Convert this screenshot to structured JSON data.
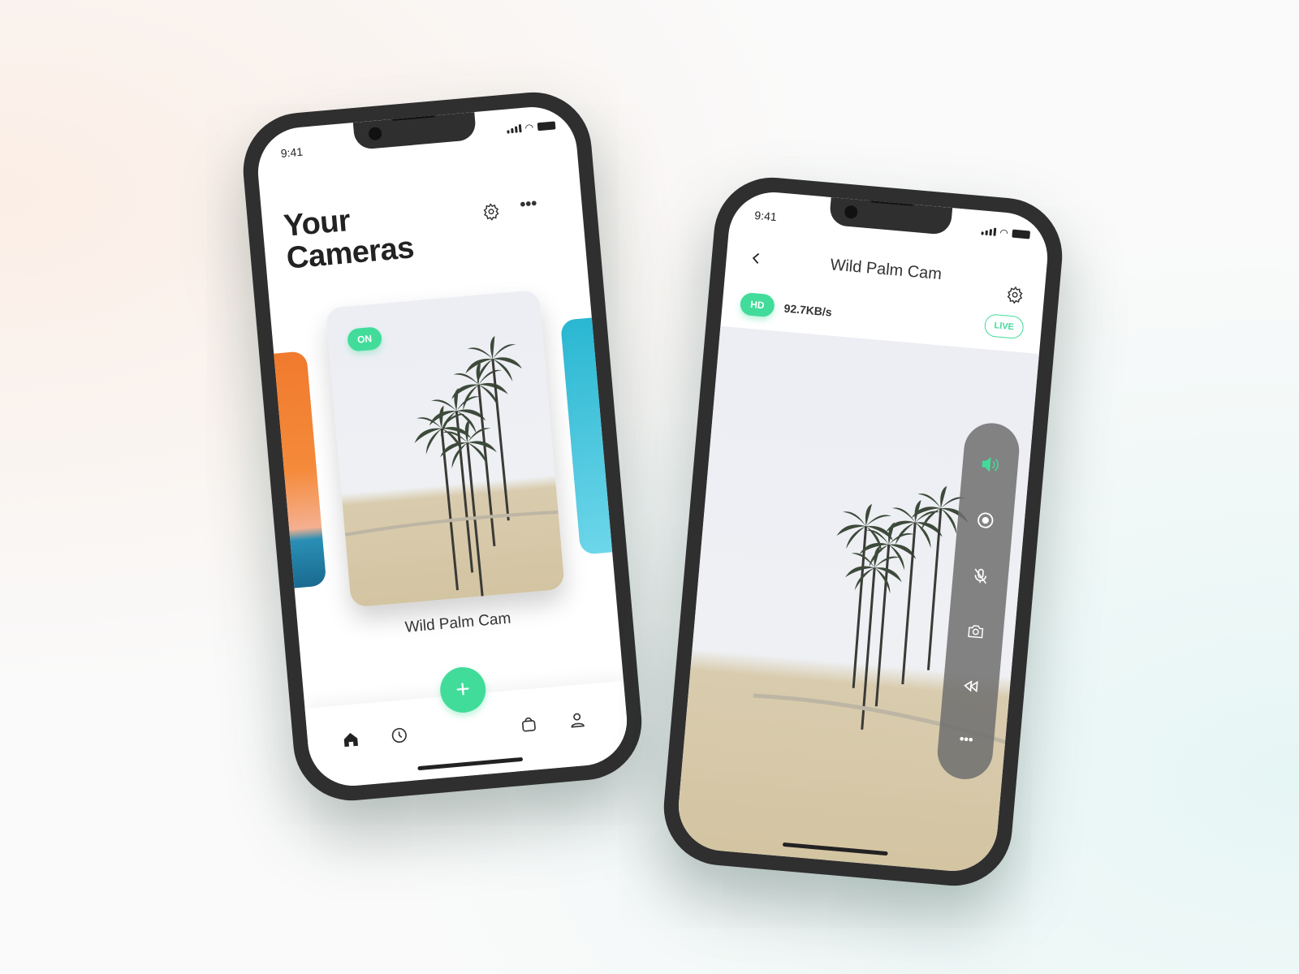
{
  "status": {
    "time": "9:41"
  },
  "list_screen": {
    "title_line1": "Your",
    "title_line2": "Cameras",
    "settings_icon": "gear-icon",
    "more_icon": "more-horizontal-icon",
    "camera_card": {
      "status_badge": "ON",
      "name": "Wild Palm Cam"
    },
    "nav": {
      "items": [
        "home-icon",
        "clock-icon",
        "add-icon",
        "shopping-bag-icon",
        "user-icon"
      ],
      "add_label": "+"
    }
  },
  "detail_screen": {
    "title": "Wild Palm Cam",
    "back_icon": "chevron-left-icon",
    "settings_icon": "gear-icon",
    "quality_badge": "HD",
    "bitrate": "92.7KB/s",
    "live_badge": "LIVE",
    "controls": [
      "speaker-icon",
      "record-icon",
      "mic-off-icon",
      "camera-icon",
      "rewind-icon",
      "more-horizontal-icon"
    ]
  },
  "colors": {
    "accent": "#42dc9a",
    "frame": "#2f2f2f"
  }
}
